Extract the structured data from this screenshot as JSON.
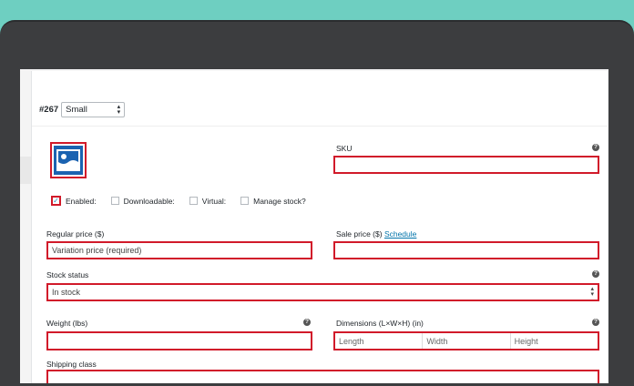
{
  "variation": {
    "id": "#267",
    "size_value": "Small"
  },
  "sku": {
    "label": "SKU",
    "value": ""
  },
  "options": [
    {
      "label": "Enabled:",
      "checked": true
    },
    {
      "label": "Downloadable:",
      "checked": false
    },
    {
      "label": "Virtual:",
      "checked": false
    },
    {
      "label": "Manage stock?",
      "checked": false
    }
  ],
  "regular_price": {
    "label": "Regular price ($)",
    "placeholder": "Variation price (required)"
  },
  "sale_price": {
    "label": "Sale price ($)",
    "schedule_link": "Schedule",
    "value": ""
  },
  "stock_status": {
    "label": "Stock status",
    "value": "In stock"
  },
  "weight": {
    "label": "Weight (lbs)",
    "value": ""
  },
  "dimensions": {
    "label": "Dimensions (L×W×H) (in)",
    "length": "Length",
    "width": "Width",
    "height": "Height"
  },
  "shipping_class": {
    "label": "Shipping class"
  },
  "colors": {
    "highlight": "#d11a2a",
    "link": "#0073aa",
    "background": "#6ecfc1",
    "image_blue": "#1b63b1"
  }
}
